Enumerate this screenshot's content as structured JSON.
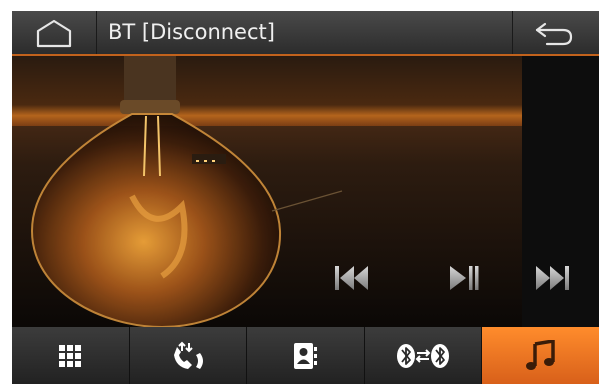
{
  "header": {
    "title": "BT [Disconnect]",
    "home_icon": "home-icon",
    "back_icon": "back-arrow-icon"
  },
  "player": {
    "controls": [
      {
        "name": "previous-track",
        "icon": "skip-previous-icon"
      },
      {
        "name": "play-pause",
        "icon": "play-pause-icon"
      },
      {
        "name": "next-track",
        "icon": "skip-next-icon"
      }
    ]
  },
  "bottom_tabs": [
    {
      "name": "keypad",
      "icon": "dialpad-grid-icon",
      "active": false
    },
    {
      "name": "call-log",
      "icon": "phone-transfer-icon",
      "active": false
    },
    {
      "name": "contacts",
      "icon": "contacts-book-icon",
      "active": false
    },
    {
      "name": "bluetooth-pairing",
      "icon": "bluetooth-connect-icon",
      "active": false
    },
    {
      "name": "music",
      "icon": "music-note-icon",
      "active": true
    }
  ],
  "colors": {
    "accent": "#e8701f",
    "bar_bg": "#2f2f2f",
    "text": "#f0f0f0"
  }
}
